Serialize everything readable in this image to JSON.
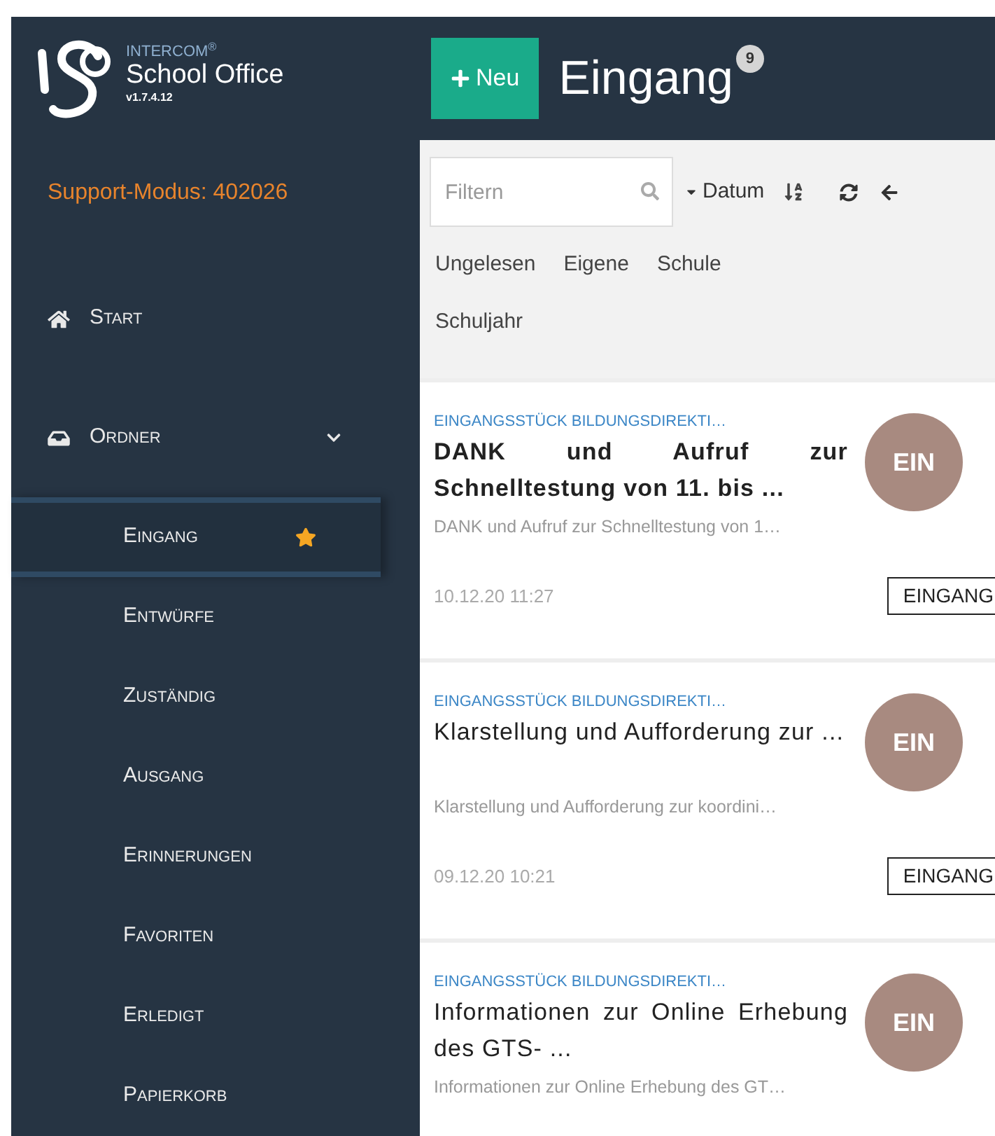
{
  "brand": {
    "company": "INTERCOM",
    "reg": "®",
    "product": "School Office",
    "version": "v1.7.4.12"
  },
  "support": "Support-Modus: 402026",
  "nav": [
    {
      "label": "Start"
    },
    {
      "label": "Ordner",
      "expanded": true,
      "children": [
        {
          "label": "Eingang",
          "selected": true,
          "starred": true
        },
        {
          "label": "Entwürfe",
          "selected": false,
          "starred": false
        },
        {
          "label": "Zuständig",
          "selected": false,
          "starred": false
        },
        {
          "label": "Ausgang",
          "selected": false,
          "starred": false
        },
        {
          "label": "Erinnerungen",
          "selected": false,
          "starred": false
        },
        {
          "label": "Favoriten",
          "selected": false,
          "starred": false
        },
        {
          "label": "Erledigt",
          "selected": false,
          "starred": false
        },
        {
          "label": "Papierkorb",
          "selected": false,
          "starred": false
        }
      ]
    }
  ],
  "new_button": "Neu",
  "title": "Eingang",
  "count": "9",
  "filter": {
    "placeholder": "Filtern"
  },
  "sort": "Datum",
  "filters": [
    "Ungelesen",
    "Eigene",
    "Schule",
    "Schuljahr"
  ],
  "messages": [
    {
      "category": "EINGANGSSTÜCK BILDUNGSDIREKTI…",
      "title": "DANK und Aufruf zur Schnelltestung von 11. bis ...",
      "unread": true,
      "preview": "DANK und Aufruf zur Schnelltestung von 1…",
      "avatar": "EIN",
      "date": "10.12.20 11:27",
      "folder": "EINGANG"
    },
    {
      "category": "EINGANGSSTÜCK BILDUNGSDIREKTI…",
      "title": "Klarstellung und Aufforderung zur ...",
      "unread": false,
      "preview": "Klarstellung und Aufforderung zur koordini…",
      "avatar": "EIN",
      "date": "09.12.20 10:21",
      "folder": "EINGANG"
    },
    {
      "category": "EINGANGSSTÜCK BILDUNGSDIREKTI…",
      "title": "Informationen zur Online Erhebung des GTS- ...",
      "unread": false,
      "preview": "Informationen zur Online Erhebung des GT…",
      "avatar": "EIN"
    }
  ]
}
